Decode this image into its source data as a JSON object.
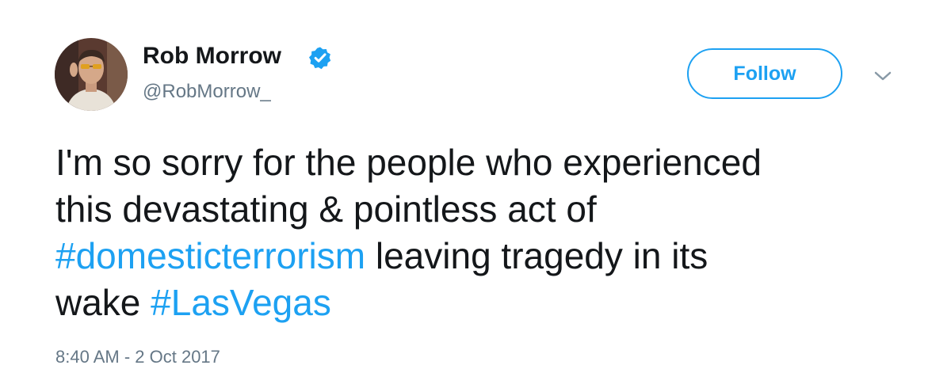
{
  "author": {
    "display_name": "Rob Morrow",
    "handle": "@RobMorrow_",
    "verified": true,
    "avatar_icon": "profile-photo"
  },
  "actions": {
    "follow_label": "Follow",
    "more_icon": "chevron-down-icon"
  },
  "tweet": {
    "line1": "I'm so sorry for the people who experienced",
    "line2": "this devastating & pointless act of",
    "line3_hashtag": "#domesticterrorism",
    "line3_text": " leaving tragedy in its",
    "line4_text": "wake ",
    "line4_hashtag": "#LasVegas"
  },
  "timestamp": "8:40 AM - 2 Oct 2017",
  "colors": {
    "accent": "#1da1f2",
    "text": "#14171a",
    "muted": "#657786"
  }
}
